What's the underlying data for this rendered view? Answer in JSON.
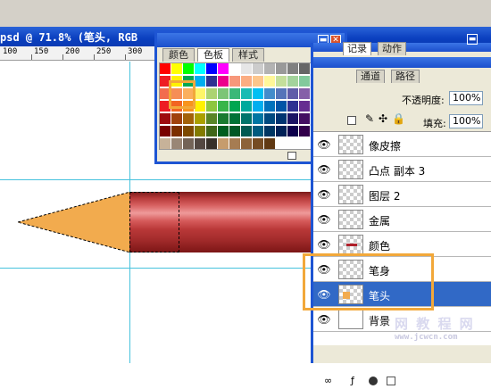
{
  "document": {
    "title": "psd @ 71.8% (笔头, RGB",
    "ruler_labels": [
      "100",
      "150",
      "200",
      "250",
      "300"
    ]
  },
  "swatches_panel": {
    "tabs": [
      "颜色",
      "色板",
      "样式"
    ],
    "active_tab": "色板"
  },
  "layers_panel": {
    "tabs": [
      "记录",
      "动作"
    ],
    "tabs2": [
      "通道",
      "路径"
    ],
    "opacity_label": "不透明度:",
    "opacity_value": "100%",
    "fill_label": "填充:",
    "fill_value": "100%",
    "layers": [
      {
        "name": "像皮擦",
        "selected": false
      },
      {
        "name": "凸点 副本 3",
        "selected": false
      },
      {
        "name": "图层 2",
        "selected": false
      },
      {
        "name": "金属",
        "selected": false
      },
      {
        "name": "颜色",
        "selected": false
      },
      {
        "name": "笔身",
        "selected": false
      },
      {
        "name": "笔头",
        "selected": true
      },
      {
        "name": "背景",
        "selected": false
      }
    ]
  },
  "watermark": {
    "text": "网 教 程 网",
    "url": "www.jcwcn.com"
  },
  "colors": {
    "pencil_tip": "#f2ab4e",
    "highlight": "#f2a83a",
    "title_bar": "#1e55d3",
    "selected_layer": "#3169c6"
  }
}
